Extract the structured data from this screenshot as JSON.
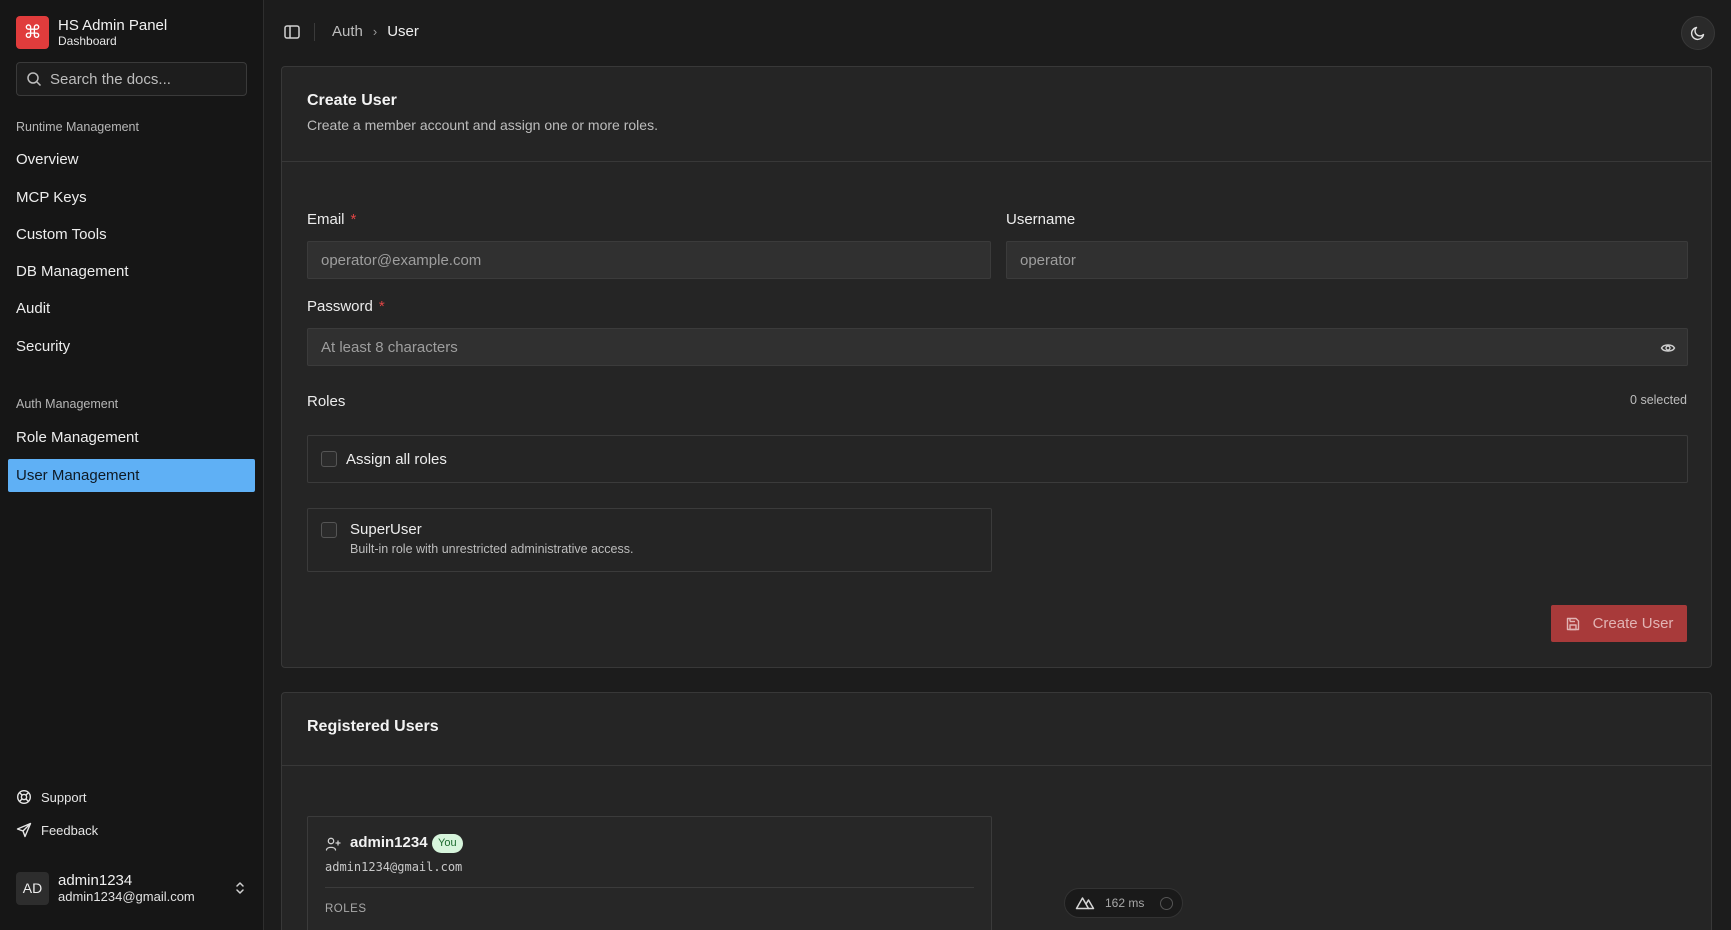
{
  "brand": {
    "logo_glyph": "⌘",
    "title": "HS Admin Panel",
    "subtitle": "Dashboard",
    "color": "#e03c3c"
  },
  "search": {
    "placeholder": "Search the docs..."
  },
  "sidebar": {
    "groups": [
      {
        "label": "Runtime Management",
        "items": [
          "Overview",
          "MCP Keys",
          "Custom Tools",
          "DB Management",
          "Audit",
          "Security"
        ]
      },
      {
        "label": "Auth Management",
        "items": [
          "Role Management",
          "User Management"
        ]
      }
    ],
    "active_item": "User Management",
    "active_color": "#5fb0f5",
    "footer": {
      "support": "Support",
      "feedback": "Feedback"
    },
    "user": {
      "initials": "AD",
      "name": "admin1234",
      "email": "admin1234@gmail.com"
    }
  },
  "breadcrumb": {
    "parent": "Auth",
    "separator": "›",
    "current": "User"
  },
  "create_user": {
    "title": "Create User",
    "description": "Create a member account and assign one or more roles.",
    "email": {
      "label": "Email",
      "required_mark": "*",
      "placeholder": "operator@example.com"
    },
    "username": {
      "label": "Username",
      "placeholder": "operator"
    },
    "password": {
      "label": "Password",
      "required_mark": "*",
      "placeholder": "At least 8 characters"
    },
    "roles": {
      "label": "Roles",
      "count_text": "0 selected",
      "assign_all_label": "Assign all roles",
      "items": [
        {
          "name": "SuperUser",
          "description": "Built-in role with unrestricted administrative access."
        }
      ]
    },
    "submit_label": "Create User",
    "submit_color": "#a83a3a"
  },
  "registered_users": {
    "title": "Registered Users",
    "users": [
      {
        "name": "admin1234",
        "badge": "You",
        "email": "admin1234@gmail.com",
        "roles_label": "ROLES"
      }
    ]
  },
  "perf_badge": {
    "ms": "162 ms"
  }
}
